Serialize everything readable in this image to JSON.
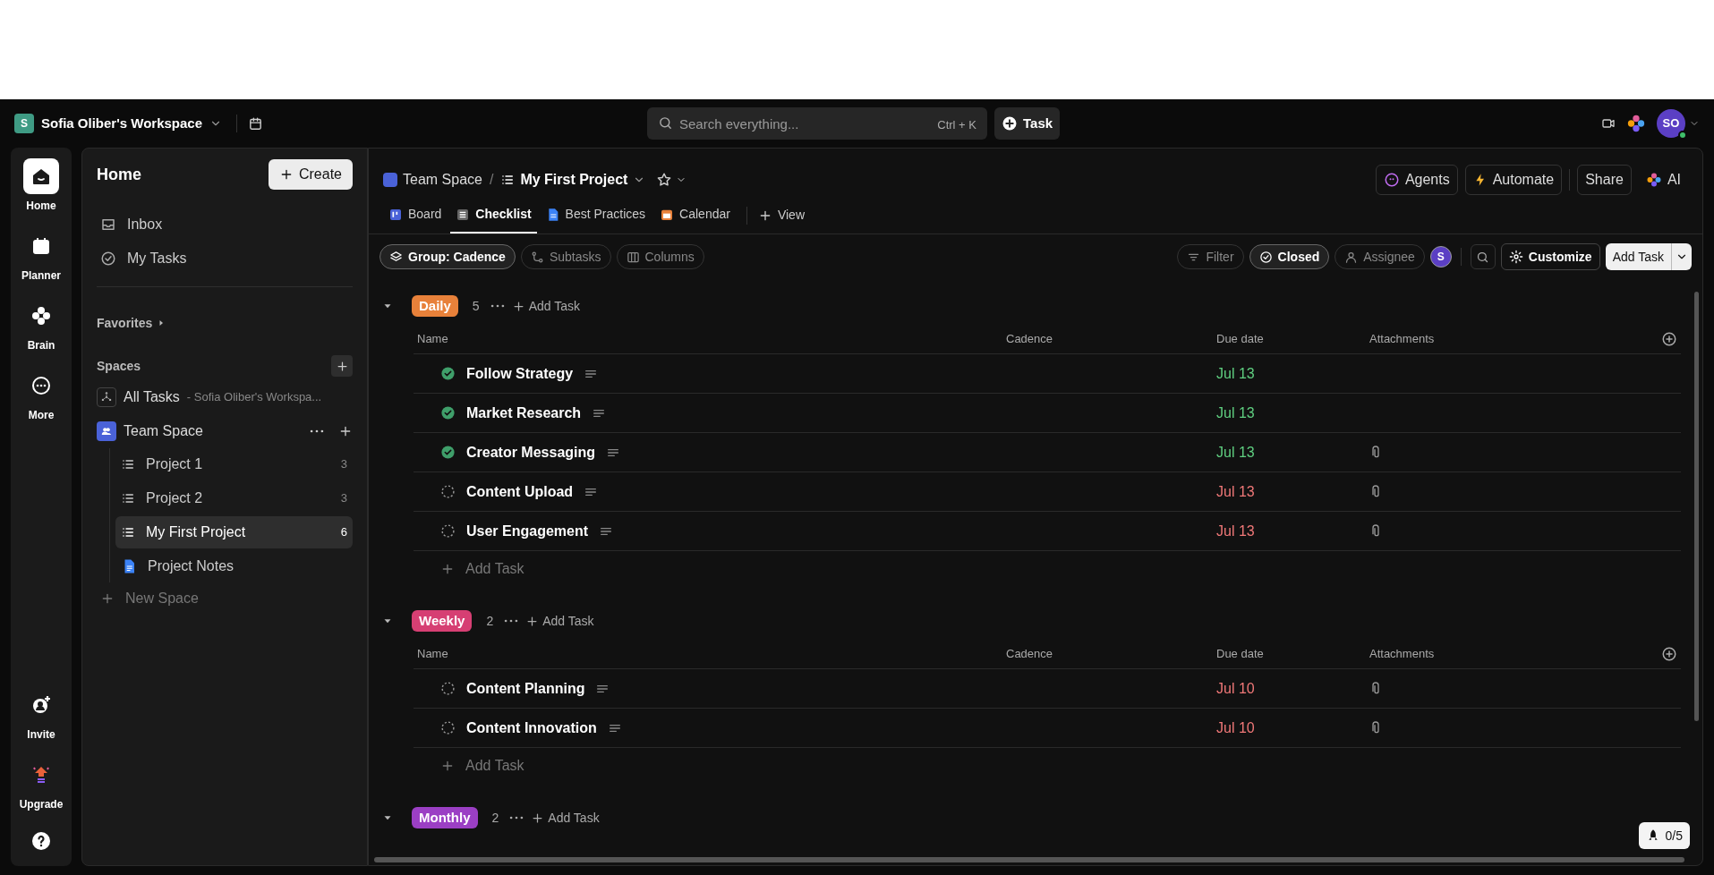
{
  "topbar": {
    "workspace_initial": "S",
    "workspace": "Sofia Oliber's Workspace",
    "search_placeholder": "Search everything...",
    "shortcut": "Ctrl + K",
    "task_button": "Task",
    "avatar": "SO"
  },
  "rail": {
    "top": [
      {
        "label": "Home",
        "selected": true
      },
      {
        "label": "Planner",
        "selected": false
      },
      {
        "label": "Brain",
        "selected": false
      },
      {
        "label": "More",
        "selected": false
      }
    ],
    "bottom": [
      {
        "label": "Invite"
      },
      {
        "label": "Upgrade"
      }
    ]
  },
  "sidebar": {
    "title": "Home",
    "create": "Create",
    "nav": [
      {
        "label": "Inbox"
      },
      {
        "label": "My Tasks"
      }
    ],
    "favorites": "Favorites",
    "spaces": "Spaces",
    "all_tasks": "All Tasks",
    "all_tasks_sub": "- Sofia Oliber's Workspa...",
    "space": "Team Space",
    "items": [
      {
        "label": "Project 1",
        "count": "3",
        "kind": "list",
        "selected": false
      },
      {
        "label": "Project 2",
        "count": "3",
        "kind": "list",
        "selected": false
      },
      {
        "label": "My First Project",
        "count": "6",
        "kind": "list",
        "selected": true
      },
      {
        "label": "Project Notes",
        "kind": "doc",
        "selected": false
      }
    ],
    "new_space": "New Space"
  },
  "header": {
    "breadcrumb": [
      "Team Space",
      "My First Project"
    ],
    "separator": "/",
    "actions": [
      "Agents",
      "Automate",
      "Share",
      "AI"
    ],
    "tabs": [
      {
        "label": "Board",
        "selected": false
      },
      {
        "label": "Checklist",
        "selected": true
      },
      {
        "label": "Best Practices",
        "selected": false
      },
      {
        "label": "Calendar",
        "selected": false
      }
    ],
    "add_view": "View"
  },
  "toolbar": {
    "left": [
      {
        "label": "Group: Cadence",
        "active": true
      },
      {
        "label": "Subtasks",
        "active": false
      },
      {
        "label": "Columns",
        "active": false
      }
    ],
    "right": [
      {
        "label": "Filter",
        "active": false
      },
      {
        "label": "Closed",
        "active": true
      },
      {
        "label": "Assignee",
        "active": false
      }
    ],
    "assignee_initial": "S",
    "customize": "Customize",
    "add_task": "Add Task"
  },
  "groups": [
    {
      "name": "Daily",
      "color": "#e8813a",
      "count": "5",
      "add": "Add Task",
      "columns": [
        "Name",
        "Cadence",
        "Due date",
        "Attachments"
      ],
      "tasks": [
        {
          "name": "Follow Strategy",
          "done": true,
          "due": "Jul 13",
          "attachment": false
        },
        {
          "name": "Market Research",
          "done": true,
          "due": "Jul 13",
          "attachment": false
        },
        {
          "name": "Creator Messaging",
          "done": true,
          "due": "Jul 13",
          "attachment": true
        },
        {
          "name": "Content Upload",
          "done": false,
          "due": "Jul 13",
          "attachment": true
        },
        {
          "name": "User Engagement",
          "done": false,
          "due": "Jul 13",
          "attachment": true
        }
      ],
      "add_row": "Add Task"
    },
    {
      "name": "Weekly",
      "color": "#d63f73",
      "count": "2",
      "add": "Add Task",
      "columns": [
        "Name",
        "Cadence",
        "Due date",
        "Attachments"
      ],
      "tasks": [
        {
          "name": "Content Planning",
          "done": false,
          "due": "Jul 10",
          "attachment": true
        },
        {
          "name": "Content Innovation",
          "done": false,
          "due": "Jul 10",
          "attachment": true
        }
      ],
      "add_row": "Add Task"
    },
    {
      "name": "Monthly",
      "color": "#9b3fc4",
      "count": "2",
      "add": "Add Task"
    }
  ],
  "progress_badge": "0/5"
}
